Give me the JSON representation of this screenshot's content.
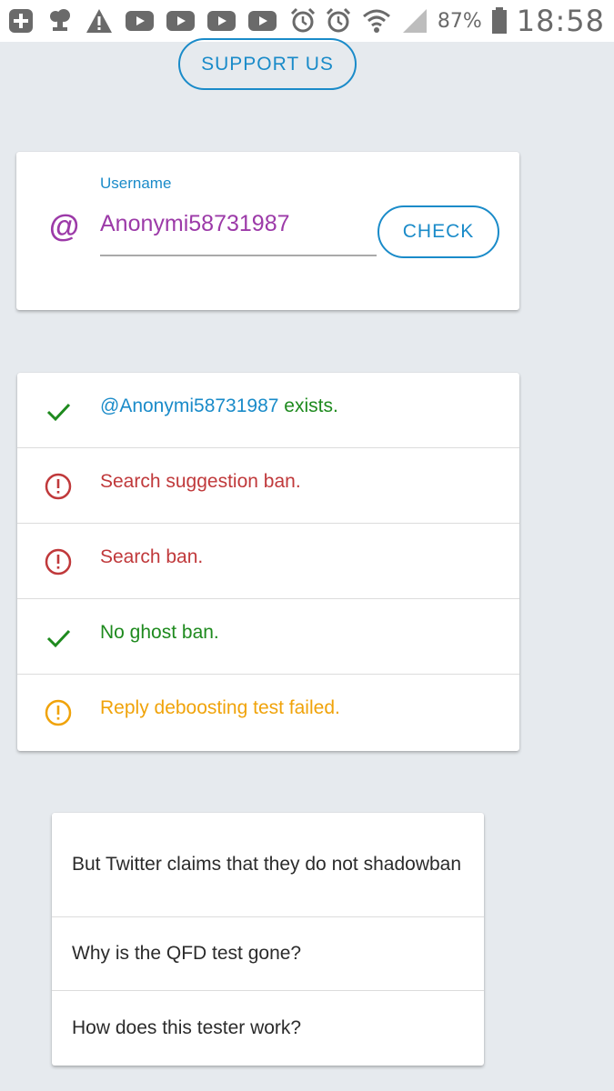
{
  "status_bar": {
    "battery_percent": "87%",
    "time": "18:58",
    "icons": [
      "plus-square-icon",
      "cloud-icon",
      "warning-icon",
      "youtube-icon",
      "youtube-icon",
      "youtube-icon",
      "youtube-icon",
      "alarm-icon",
      "alarm-icon",
      "wifi-icon",
      "signal-icon",
      "battery-icon"
    ]
  },
  "header": {
    "support_label": "SUPPORT US"
  },
  "check_form": {
    "at_symbol": "@",
    "field_label": "Username",
    "username_value": "Anonymi58731987",
    "check_label": "CHECK"
  },
  "results": [
    {
      "status": "ok",
      "icon": "checkmark-icon",
      "handle": "@Anonymi58731987",
      "text": " exists.",
      "color": "#1e8a1e",
      "handle_color": "#1a8bc9"
    },
    {
      "status": "ban",
      "icon": "alert-circle-icon",
      "text": "Search suggestion ban.",
      "color": "#c0393b"
    },
    {
      "status": "ban",
      "icon": "alert-circle-icon",
      "text": "Search ban.",
      "color": "#c0393b"
    },
    {
      "status": "ok",
      "icon": "checkmark-icon",
      "text": "No ghost ban.",
      "color": "#1e8a1e"
    },
    {
      "status": "warn",
      "icon": "alert-circle-icon",
      "text": "Reply deboosting test failed.",
      "color": "#f0a30a"
    }
  ],
  "faq": [
    "But Twitter claims that they do not shadowban",
    "Why is the QFD test gone?",
    "How does this tester work?"
  ],
  "colors": {
    "accent": "#1a8bc9",
    "username": "#9c3aa8",
    "background": "#e6eaee"
  }
}
